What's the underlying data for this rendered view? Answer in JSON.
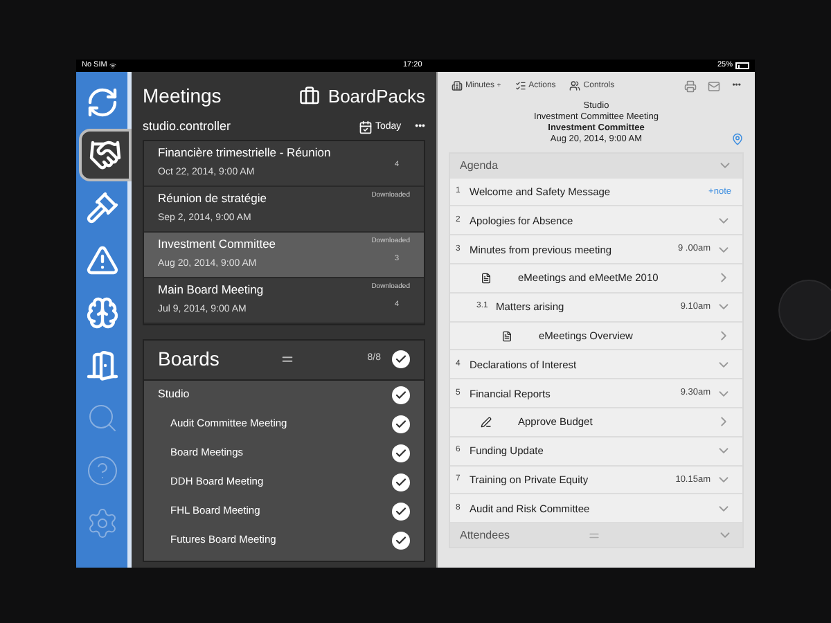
{
  "status_bar": {
    "carrier": "No SIM",
    "time": "17:20",
    "battery": "25%"
  },
  "sidebar": {
    "items": [
      {
        "selected": false,
        "disabled": false
      },
      {
        "selected": true,
        "disabled": false
      },
      {
        "selected": false,
        "disabled": false
      },
      {
        "selected": false,
        "disabled": false
      },
      {
        "selected": false,
        "disabled": false
      },
      {
        "selected": false,
        "disabled": false
      },
      {
        "selected": false,
        "disabled": true
      },
      {
        "selected": false,
        "disabled": true
      },
      {
        "selected": false,
        "disabled": true
      }
    ]
  },
  "meetings": {
    "title": "Meetings",
    "brand": "BoardPacks",
    "user": "studio.controller",
    "today": "Today",
    "more": "•••",
    "items": [
      {
        "title": "Financière trimestrielle - Réunion",
        "date": "Oct 22, 2014, 9:00 AM",
        "count": "4",
        "selected": false
      },
      {
        "title": "Réunion de stratégie",
        "date": "Sep 2, 2014, 9:00 AM",
        "status": "Downloaded",
        "selected": false
      },
      {
        "title": "Investment Committee",
        "date": "Aug 20, 2014, 9:00 AM",
        "status": "Downloaded",
        "count": "3",
        "selected": true
      },
      {
        "title": "Main Board Meeting",
        "date": "Jul 9, 2014, 9:00 AM",
        "status": "Downloaded",
        "count": "4",
        "selected": false
      }
    ]
  },
  "boards": {
    "title": "Boards",
    "count": "8/8",
    "checked": true,
    "group": {
      "name": "Studio",
      "checked": true
    },
    "items": [
      {
        "name": "Audit Committee Meeting",
        "checked": true
      },
      {
        "name": "Board Meetings",
        "checked": true
      },
      {
        "name": "DDH Board Meeting",
        "checked": true
      },
      {
        "name": "FHL Board Meeting",
        "checked": true
      },
      {
        "name": "Futures Board Meeting",
        "checked": true
      }
    ]
  },
  "toolbar": {
    "minutes": "Minutes",
    "minutes_caret": "+",
    "actions": "Actions",
    "controls": "Controls",
    "more": "•••"
  },
  "meeting_header": {
    "board": "Studio",
    "meeting": "Investment Committee Meeting",
    "name": "Investment Committee",
    "date": "Aug 20, 2014, 9:00 AM"
  },
  "agenda": {
    "title": "Agenda",
    "footer": "Attendees",
    "items": [
      {
        "kind": "item",
        "number": "1",
        "title": "Welcome and Safety Message",
        "note": "+note"
      },
      {
        "kind": "item",
        "number": "2",
        "title": "Apologies for Absence"
      },
      {
        "kind": "item",
        "number": "3",
        "title": "Minutes from previous meeting",
        "time": "9 .00am"
      },
      {
        "kind": "document",
        "title": "eMeetings and eMeetMe 2010"
      },
      {
        "kind": "subitem",
        "number": "3.1",
        "title": "Matters arising",
        "time": "9.10am"
      },
      {
        "kind": "document",
        "title": "eMeetings Overview"
      },
      {
        "kind": "item",
        "number": "4",
        "title": "Declarations of Interest"
      },
      {
        "kind": "item",
        "number": "5",
        "title": "Financial Reports",
        "time": "9.30am"
      },
      {
        "kind": "action",
        "title": "Approve Budget"
      },
      {
        "kind": "item",
        "number": "6",
        "title": "Funding Update"
      },
      {
        "kind": "item",
        "number": "7",
        "title": "Training on Private Equity",
        "time": "10.15am"
      },
      {
        "kind": "item",
        "number": "8",
        "title": "Audit and Risk Committee"
      }
    ]
  }
}
